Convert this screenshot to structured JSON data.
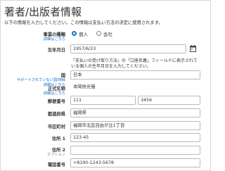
{
  "page": {
    "title": "著者/出版者情報",
    "intro": "以下の情報を入力してください。この情報は支払い方法の決定に使用されます。"
  },
  "entity_type": {
    "label": "事業の種類",
    "sub": "詳細はこちら",
    "options": [
      "個人",
      "会社"
    ],
    "selected": "個人"
  },
  "dob": {
    "label": "生年月日",
    "value": "1957/6/23",
    "note_line1": "「支払いの受け取り方法」の「口座名義」フィールドに表示されて",
    "note_line2": "いる個人の生年月日を入力してください。"
  },
  "country": {
    "label": "国",
    "sub1": "サポートされていない国/地域",
    "sub2": "詳細はこちら",
    "value": "日本"
  },
  "formal_name": {
    "label": "正式名称",
    "sub": "詳細はこちら",
    "value": "本岡依光慢"
  },
  "postal": {
    "label": "郵便番号",
    "value1": "111",
    "value2": "3456"
  },
  "prefecture": {
    "label": "都道府県",
    "value": "福岡県"
  },
  "city": {
    "label": "市区町村",
    "value": "福岡市北区自由が丘1丁目"
  },
  "address1": {
    "label": "住所 1",
    "value": "123-45"
  },
  "address2": {
    "label": "住所 2",
    "sub": "オプション",
    "value": ""
  },
  "phone": {
    "label": "電話番号",
    "value": "+8190-1243-5678"
  },
  "colors": {
    "link": "#0a6bc9",
    "radio_selected": "#1a73c9",
    "border": "#b9b9b9"
  }
}
